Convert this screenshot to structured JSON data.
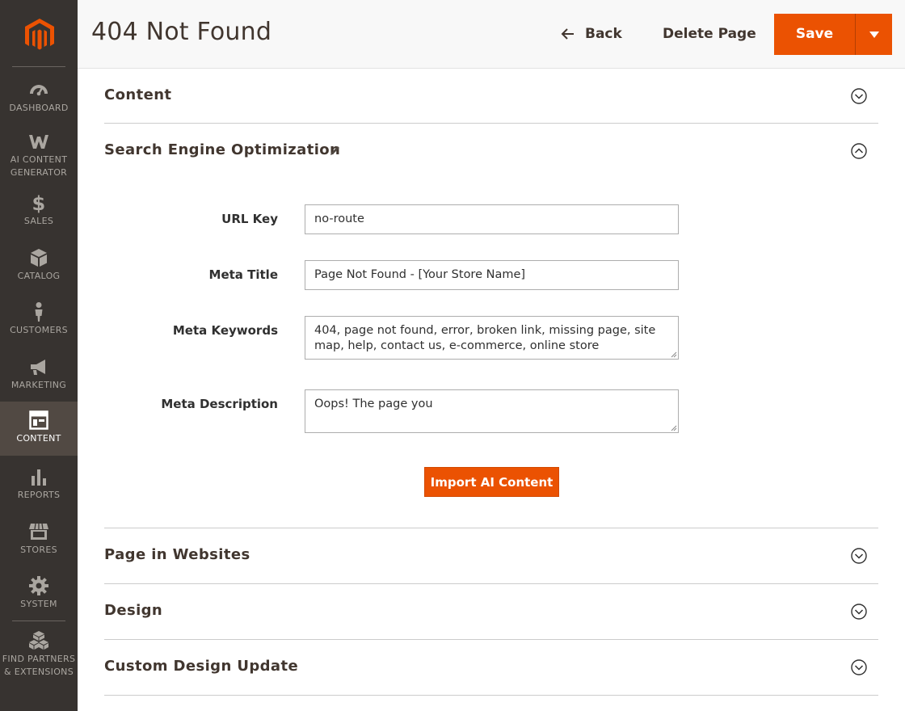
{
  "header": {
    "title": "404 Not Found",
    "back_label": "Back",
    "delete_label": "Delete Page",
    "save_label": "Save"
  },
  "sidebar": {
    "items": [
      {
        "label": "DASHBOARD",
        "icon": "dashboard-icon"
      },
      {
        "label_line1": "AI CONTENT",
        "label_line2": "GENERATOR",
        "icon": "ai-content-generator-icon"
      },
      {
        "label": "SALES",
        "icon": "dollar-icon"
      },
      {
        "label": "CATALOG",
        "icon": "box-icon"
      },
      {
        "label": "CUSTOMERS",
        "icon": "person-icon"
      },
      {
        "label": "MARKETING",
        "icon": "megaphone-icon"
      },
      {
        "label": "CONTENT",
        "icon": "layout-icon",
        "active": true
      },
      {
        "label": "REPORTS",
        "icon": "bar-chart-icon"
      },
      {
        "label": "STORES",
        "icon": "storefront-icon"
      },
      {
        "label": "SYSTEM",
        "icon": "gear-icon"
      },
      {
        "label_line1": "FIND PARTNERS",
        "label_line2": "& EXTENSIONS",
        "icon": "cubes-icon"
      }
    ]
  },
  "sections": {
    "content": "Content",
    "seo": "Search Engine Optimization",
    "websites": "Page in Websites",
    "design": "Design",
    "custom_design": "Custom Design Update"
  },
  "seo_form": {
    "url_key_label": "URL Key",
    "url_key_value": "no-route",
    "meta_title_label": "Meta Title",
    "meta_title_value": "Page Not Found - [Your Store Name]",
    "meta_keywords_label": "Meta Keywords",
    "meta_keywords_value": "404, page not found, error, broken link, missing page, site map, help, contact us, e-commerce, online store",
    "meta_description_label": "Meta Description",
    "meta_description_value": "Oops! The page you",
    "import_button": "Import AI Content"
  },
  "colors": {
    "accent": "#eb5202",
    "sidebar_bg": "#373330",
    "sidebar_active": "#514943"
  }
}
